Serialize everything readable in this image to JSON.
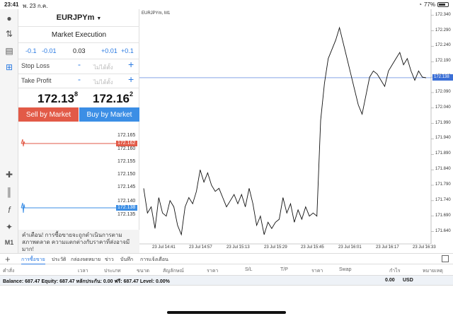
{
  "status": {
    "time": "23:41",
    "date": "พ. 23 ก.ค.",
    "battery": "77%",
    "battery_level": 0.77
  },
  "order": {
    "symbol": "EURJPYm",
    "execution": "Market Execution",
    "volumes": [
      "-0.1",
      "-0.01",
      "0.03",
      "+0.01",
      "+0.1"
    ],
    "stop_loss_label": "Stop Loss",
    "take_profit_label": "Take Profit",
    "placeholder": "ไม่ได้ตั้ง",
    "minus": "-",
    "plus": "+",
    "bid_main": "172.13",
    "bid_sup": "8",
    "ask_main": "172.16",
    "ask_sup": "2",
    "sell_label": "Sell by Market",
    "buy_label": "Buy by Market",
    "mini_ticks": [
      "172.165",
      "172.160",
      "172.155",
      "172.150",
      "172.145",
      "172.140",
      "172.135"
    ],
    "ask_tag": "172.162",
    "bid_tag": "172.138",
    "warning": "คำเตือน! การซื้อขายจะถูกดำเนินการตามสภาพตลาด ความแตกต่างกับราคาที่ส่งอาจมีมาก!"
  },
  "chart": {
    "title": "EURJPYm, M1",
    "current_price": "172.138",
    "y_ticks": [
      "172.340",
      "172.290",
      "172.240",
      "172.190",
      "172.140",
      "172.090",
      "172.040",
      "171.990",
      "171.940",
      "171.890",
      "171.840",
      "171.790",
      "171.740",
      "171.690",
      "171.640"
    ],
    "x_ticks": [
      "23 Jul 14:41",
      "23 Jul 14:57",
      "23 Jul 15:13",
      "23 Jul 15:29",
      "23 Jul 15:45",
      "23 Jul 16:01",
      "23 Jul 16:17",
      "23 Jul 16:33"
    ],
    "line_color": "#3b6fd6"
  },
  "chart_data": {
    "type": "line",
    "title": "EURJPYm, M1",
    "ylim": [
      171.6,
      172.36
    ],
    "y": [
      171.78,
      171.7,
      171.72,
      171.65,
      171.75,
      171.7,
      171.69,
      171.74,
      171.72,
      171.66,
      171.63,
      171.72,
      171.75,
      171.73,
      171.77,
      171.84,
      171.8,
      171.83,
      171.79,
      171.77,
      171.78,
      171.75,
      171.72,
      171.74,
      171.76,
      171.73,
      171.76,
      171.72,
      171.78,
      171.73,
      171.66,
      171.69,
      171.63,
      171.67,
      171.65,
      171.67,
      171.68,
      171.75,
      171.7,
      171.73,
      171.67,
      171.71,
      171.68,
      171.72,
      171.69,
      171.7,
      171.69,
      172.0,
      172.12,
      172.2,
      172.23,
      172.26,
      172.3,
      172.25,
      172.2,
      172.15,
      172.1,
      172.05,
      172.02,
      172.08,
      172.14,
      172.16,
      172.15,
      172.13,
      172.11,
      172.16,
      172.18,
      172.2,
      172.22,
      172.18,
      172.2,
      172.16,
      172.13,
      172.16,
      172.14,
      172.138
    ]
  },
  "tabs": [
    "การซื้อขาย",
    "ประวัติ",
    "กล่องจดหมาย",
    "ข่าว",
    "บันทึก",
    "การแจ้งเตือน"
  ],
  "columns": [
    "คำสั่ง",
    "เวลา",
    "ประเภท",
    "ขนาด",
    "สัญลักษณ์",
    "ราคา",
    "S/L",
    "T/P",
    "ราคา",
    "Swap",
    "กำไร",
    "หมายเหตุ"
  ],
  "balance": {
    "text": "Balance: 687.47 Equity: 687.47 หลักประกัน: 0.00 ฟรี: 687.47 Level: 0.00%",
    "profit": "0.00",
    "currency": "USD"
  },
  "toolbar_labels": {
    "timeframe": "M1"
  }
}
